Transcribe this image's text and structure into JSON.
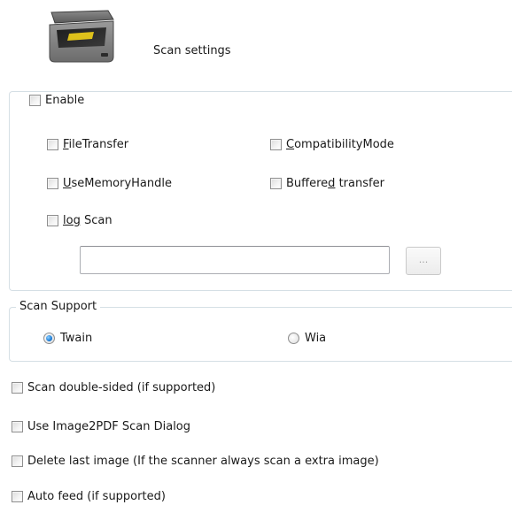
{
  "header": {
    "icon": "scanner-icon",
    "title": "Scan settings"
  },
  "enable_group": {
    "enable_label": "Enable",
    "checkboxes": {
      "file_transfer": {
        "prefix": "",
        "mnemonic": "F",
        "suffix": "ileTransfer",
        "checked": false
      },
      "compatibility_mode": {
        "prefix": "",
        "mnemonic": "C",
        "suffix": "ompatibilityMode",
        "checked": false
      },
      "use_memory_handle": {
        "prefix": "",
        "mnemonic": "U",
        "suffix": "seMemoryHandle",
        "checked": false
      },
      "buffered_transfer": {
        "prefix": "Buffere",
        "mnemonic": "d",
        "suffix": " transfer",
        "checked": false
      },
      "log_scan": {
        "prefix": "",
        "mnemonic": "log",
        "suffix": " Scan",
        "checked": false
      }
    },
    "log_path": {
      "value": "",
      "placeholder": ""
    },
    "browse_label": "..."
  },
  "scan_support": {
    "legend": "Scan Support",
    "options": {
      "twain": {
        "label": "Twain",
        "selected": true
      },
      "wia": {
        "label": "Wia",
        "selected": false
      }
    }
  },
  "options": {
    "double_sided": "Scan double-sided (if supported)",
    "use_image2pdf": "Use Image2PDF Scan Dialog",
    "delete_last": "Delete last image (If the scanner always scan a extra image)",
    "auto_feed": "Auto feed (if supported)"
  },
  "colors": {
    "group_border": "#d5dfe5",
    "radio_selected": "#1f7fd8",
    "text": "#1a1a1a"
  }
}
